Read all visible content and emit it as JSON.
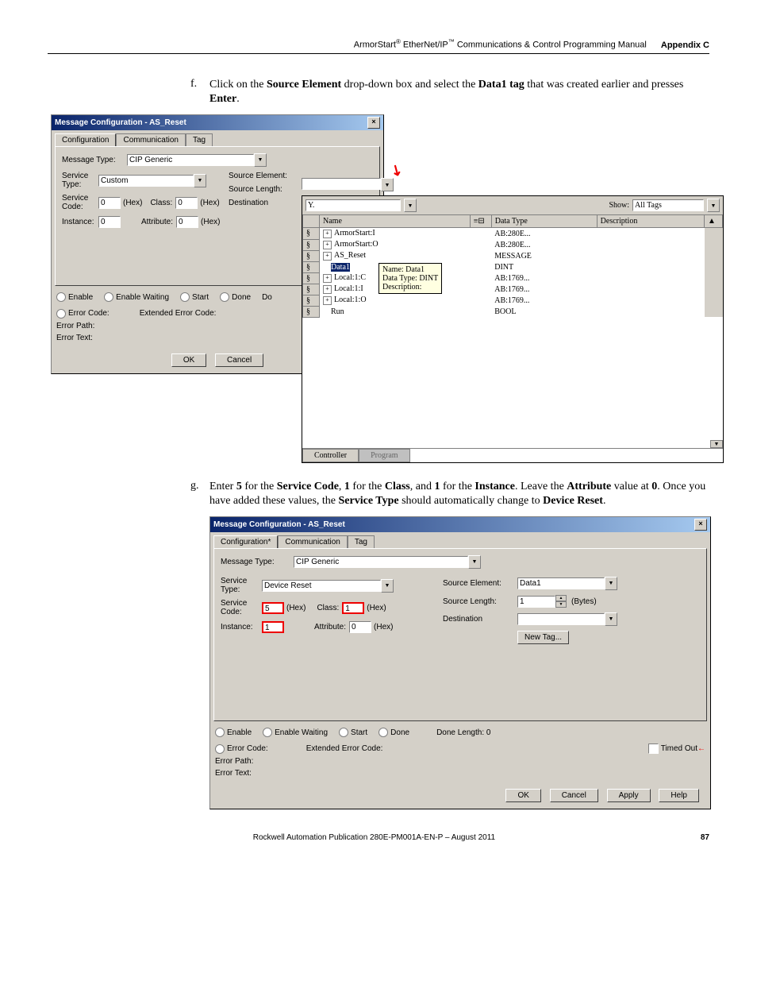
{
  "header": {
    "doctitle_prefix": "ArmorStart",
    "doctitle_mid": " EtherNet/IP",
    "doctitle_suffix": " Communications & Control Programming Manual",
    "regmark": "®",
    "tm": "™",
    "appendix": "Appendix C"
  },
  "steps": {
    "f": {
      "letter": "f.",
      "text_before": "Click on the ",
      "bold1": "Source Element",
      "text_mid": " drop-down box and select the ",
      "bold2": "Data1 tag",
      "text_after": " that was created earlier and presses ",
      "bold3": "Enter",
      "period": "."
    },
    "g": {
      "letter": "g.",
      "t1": "Enter ",
      "b1": "5",
      "t2": " for the ",
      "b2": "Service Code",
      "t3": ", ",
      "b3": "1",
      "t4": " for the ",
      "b4": "Class",
      "t5": ", and ",
      "b5": "1",
      "t6": " for the ",
      "b6": "Instance",
      "t7": ". Leave the ",
      "b7": "Attribute",
      "t8": " value at ",
      "b8": "0",
      "t9": ". Once you have added these values, the ",
      "b9": "Service Type",
      "t10": " should automatically change to ",
      "b10": "Device Reset",
      "t11": "."
    }
  },
  "dlg1": {
    "title": "Message Configuration - AS_Reset",
    "tabs": {
      "config": "Configuration",
      "comm": "Communication",
      "tag": "Tag"
    },
    "msg_type_lbl": "Message Type:",
    "msg_type": "CIP Generic",
    "service_type_lbl": "Service Type:",
    "service_type": "Custom",
    "source_element_lbl": "Source Element:",
    "source_length_lbl": "Source Length:",
    "destination_lbl": "Destination",
    "service_code_lbl": "Service Code:",
    "service_code": "0",
    "hex": "(Hex)",
    "class_lbl": "Class:",
    "class": "0",
    "instance_lbl": "Instance:",
    "instance": "0",
    "attribute_lbl": "Attribute:",
    "attribute": "0",
    "enable": "Enable",
    "enable_waiting": "Enable Waiting",
    "start": "Start",
    "done": "Done",
    "do": "Do",
    "error_code_lbl": "Error Code:",
    "ext_error": "Extended Error Code:",
    "error_path": "Error Path:",
    "error_text": "Error Text:",
    "ok": "OK",
    "cancel": "Cancel"
  },
  "tagpanel": {
    "filter": "Y.",
    "show_lbl": "Show:",
    "show": "All Tags",
    "cols": {
      "name": "Name",
      "dt": "Data Type",
      "desc": "Description"
    },
    "rows": [
      {
        "n": "ArmorStart:I",
        "dt": "AB:280E..."
      },
      {
        "n": "ArmorStart:O",
        "dt": "AB:280E..."
      },
      {
        "n": "AS_Reset",
        "dt": "MESSAGE"
      },
      {
        "n": "Data1",
        "dt": "DINT",
        "sel": true,
        "leaf": true
      },
      {
        "n": "Local:1:C",
        "dt": "AB:1769..."
      },
      {
        "n": "Local:1:I",
        "dt": "AB:1769..."
      },
      {
        "n": "Local:1:O",
        "dt": "AB:1769..."
      },
      {
        "n": "Run",
        "dt": "BOOL",
        "leaf": true
      }
    ],
    "tooltip": {
      "l1": "Name: Data1",
      "l2": "Data Type: DINT",
      "l3": "Description:"
    },
    "scope": {
      "controller": "Controller",
      "program": "Program"
    }
  },
  "dlg2": {
    "title": "Message Configuration - AS_Reset",
    "tabs": {
      "config": "Configuration*",
      "comm": "Communication",
      "tag": "Tag"
    },
    "msg_type_lbl": "Message Type:",
    "msg_type": "CIP Generic",
    "service_type_lbl": "Service Type:",
    "service_type": "Device Reset",
    "source_element_lbl": "Source Element:",
    "source_element": "Data1",
    "source_length_lbl": "Source Length:",
    "source_length": "1",
    "bytes": "(Bytes)",
    "destination_lbl": "Destination",
    "new_tag": "New Tag...",
    "service_code_lbl": "Service Code:",
    "service_code": "5",
    "hex": "(Hex)",
    "class_lbl": "Class:",
    "class": "1",
    "instance_lbl": "Instance:",
    "instance": "1",
    "attribute_lbl": "Attribute:",
    "attribute": "0",
    "enable": "Enable",
    "enable_waiting": "Enable Waiting",
    "start": "Start",
    "done": "Done",
    "done_length": "Done Length: 0",
    "error_code_lbl": "Error Code:",
    "ext_error": "Extended Error Code:",
    "timed_out": "Timed Out",
    "arrow": "←",
    "error_path": "Error Path:",
    "error_text": "Error Text:",
    "ok": "OK",
    "cancel": "Cancel",
    "apply": "Apply",
    "help": "Help"
  },
  "footer": {
    "pub": "Rockwell Automation Publication 280E-PM001A-EN-P – August 2011",
    "page": "87"
  }
}
